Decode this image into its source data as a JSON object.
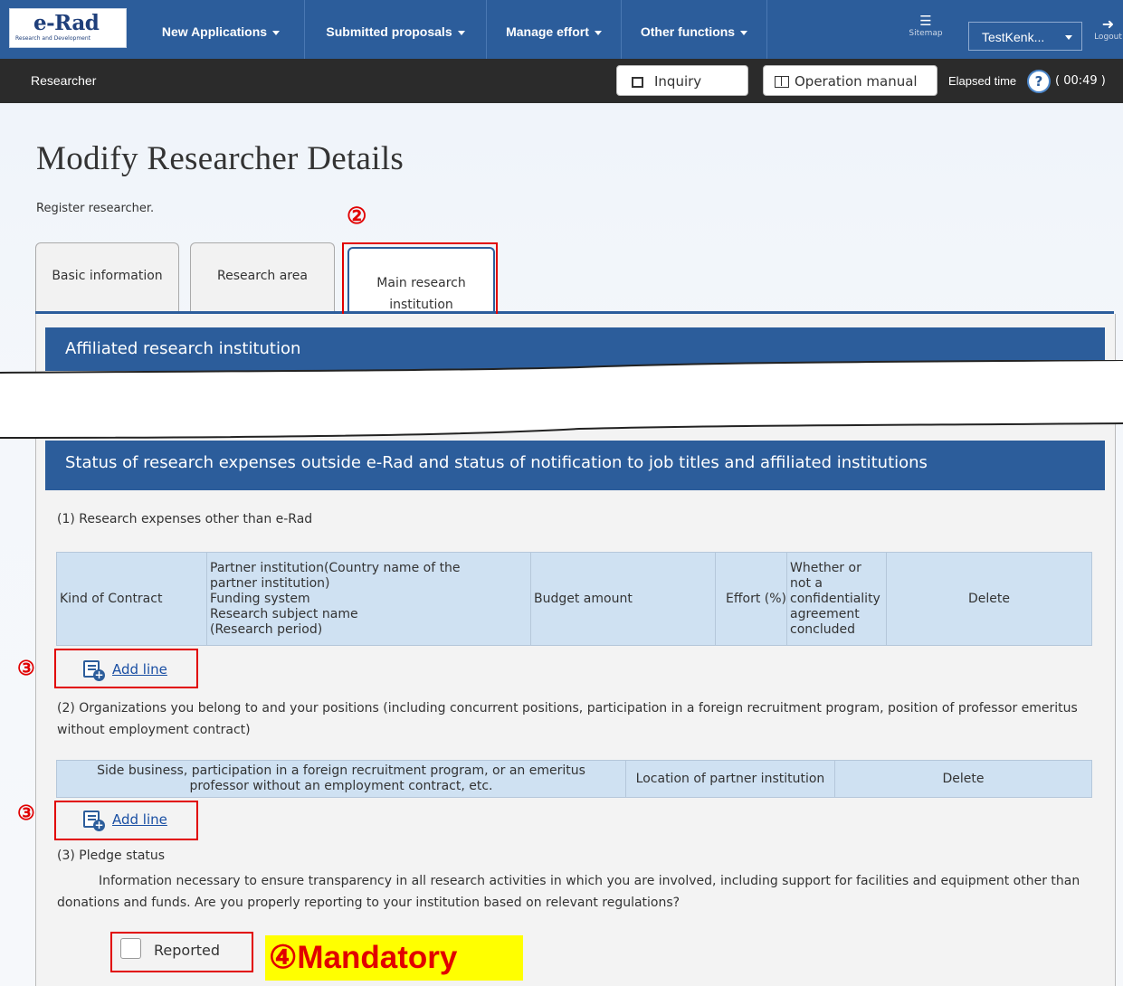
{
  "topnav": {
    "logo_text": "e-Rad",
    "logo_subtitle": "Research and Development",
    "menu": [
      {
        "label": "New Applications"
      },
      {
        "label": "Submitted proposals"
      },
      {
        "label": "Manage effort"
      },
      {
        "label": "Other functions"
      }
    ],
    "sitemap_label": "Sitemap",
    "user_select_value": "TestKenk...",
    "logout_label": "Logout"
  },
  "rolebar": {
    "role": "Researcher",
    "inquiry_label": "Inquiry",
    "manual_label": "Operation manual",
    "elapsed_label": "Elapsed time",
    "help_glyph": "?",
    "elapsed_value": "( 00:49 )"
  },
  "page": {
    "title": "Modify Researcher Details",
    "description": "Register researcher."
  },
  "tabs": [
    {
      "label": "Basic information"
    },
    {
      "label": "Research area"
    },
    {
      "label": "Main research institution"
    }
  ],
  "sections": {
    "affiliated_title": "Affiliated research institution",
    "status_title": "Status of research expenses outside e-Rad and status of notification to job titles and affiliated institutions"
  },
  "expenses": {
    "title": "(1) Research expenses other than e-Rad",
    "columns": [
      "Kind of Contract",
      "Partner institution(Country name of the partner institution)",
      "Funding system",
      "Research subject name",
      "(Research period)",
      "Budget amount",
      "Effort (%)",
      "Whether or not a confidentiality agreement concluded",
      "Delete"
    ],
    "add_label": "Add line"
  },
  "organizations": {
    "title": "(2) Organizations you belong to and your positions (including concurrent positions, participation in a foreign recruitment program, position of professor emeritus without employment contract)",
    "columns": [
      "Side business, participation in a foreign recruitment program, or an emeritus professor without an employment contract, etc.",
      "Location of partner institution",
      "Delete"
    ],
    "add_label": "Add line"
  },
  "pledge": {
    "title": "(3) Pledge status",
    "description": "Information necessary to ensure transparency in all research activities in which you are involved, including support for facilities and equipment other than donations and funds. Are you properly reporting to your institution based on relevant regulations?",
    "checkbox_label": "Reported"
  },
  "annotations": {
    "step2": "②",
    "step3": "③",
    "step4_label": "④Mandatory"
  },
  "colors": {
    "nav_blue": "#2c5d9b",
    "role_bar": "#2b2b2b",
    "header_cell": "#cfe1f2",
    "highlight_red": "#e10000",
    "mandatory_bg": "#ffff00"
  }
}
